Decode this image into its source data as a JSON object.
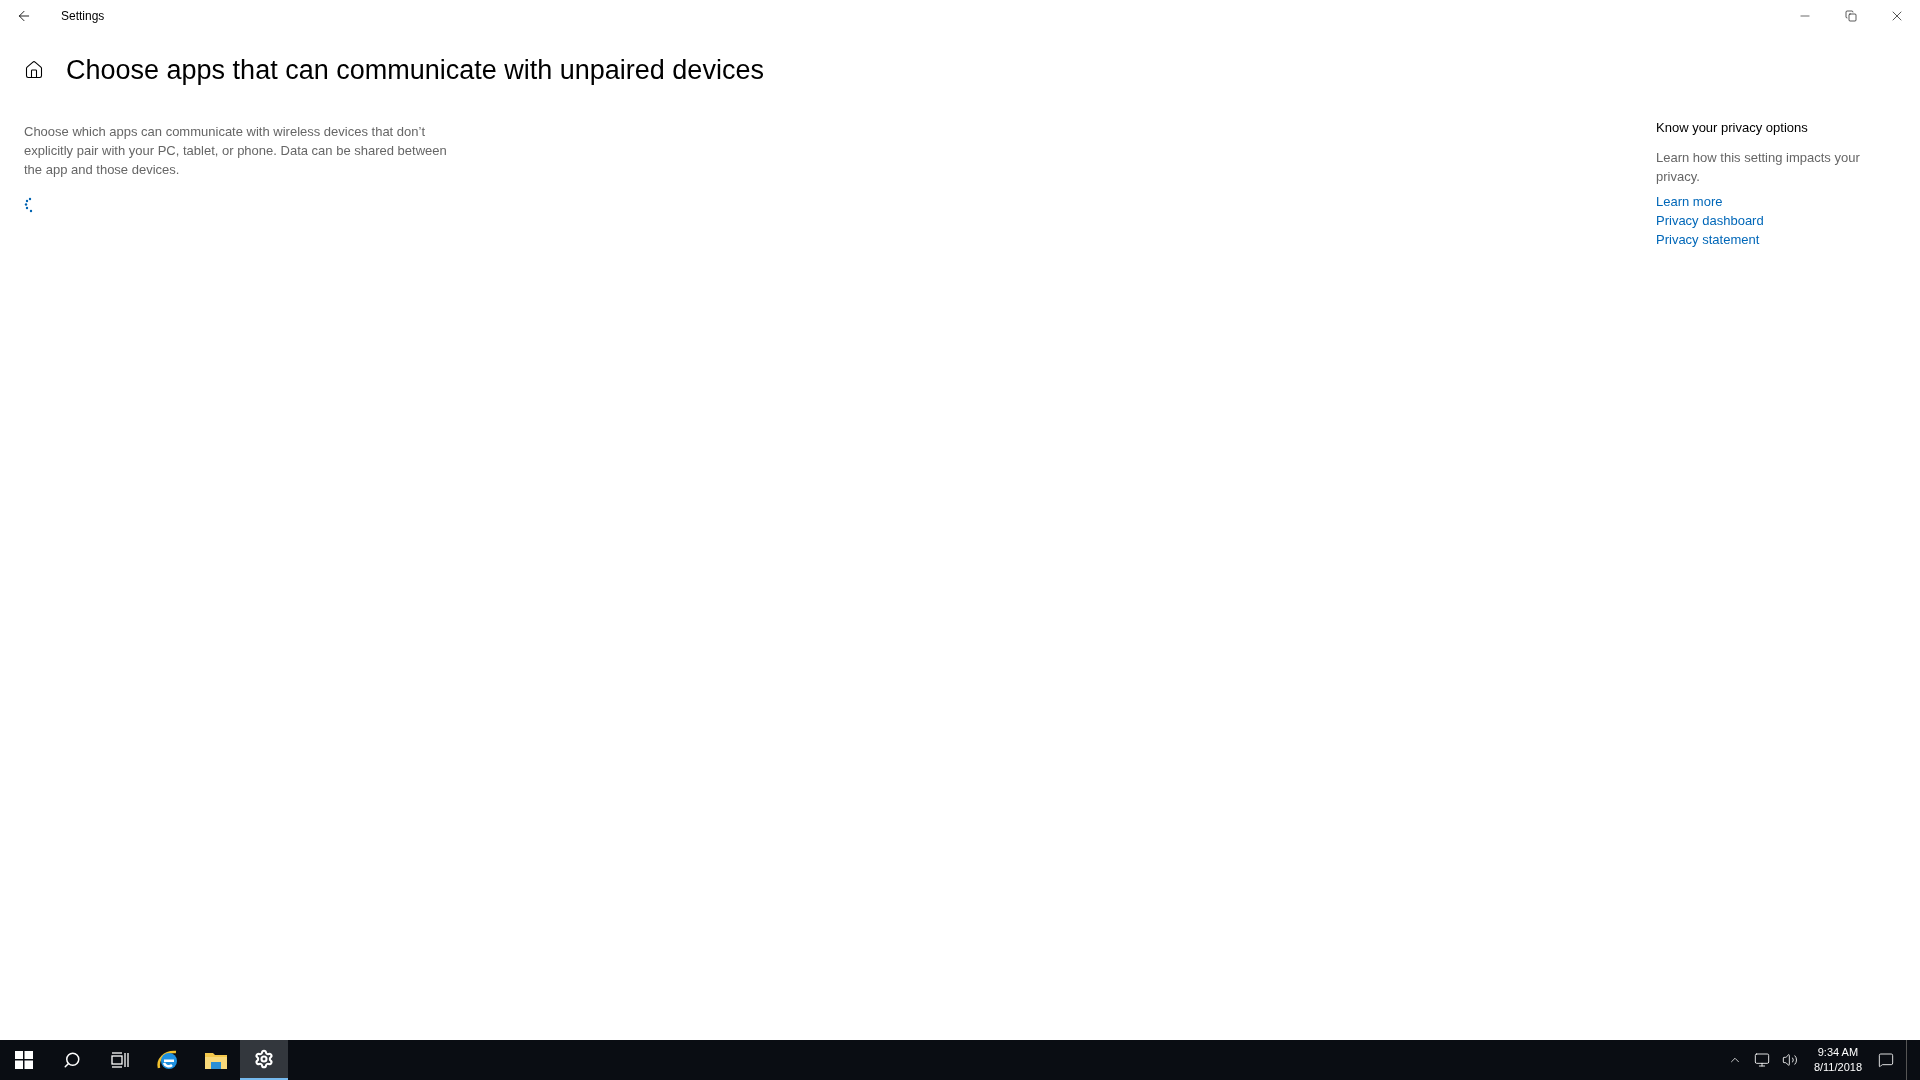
{
  "window": {
    "title": "Settings"
  },
  "page": {
    "heading": "Choose apps that can communicate with unpaired devices",
    "description": "Choose which apps can communicate with wireless devices that don’t explicitly pair with your PC, tablet, or phone. Data can be shared between the app and those devices.",
    "loading": true
  },
  "privacy_panel": {
    "title": "Know your privacy options",
    "text": "Learn how this setting impacts your privacy.",
    "links": [
      "Learn more",
      "Privacy dashboard",
      "Privacy statement"
    ]
  },
  "taskbar": {
    "items": [
      {
        "kind": "start",
        "selected": false
      },
      {
        "kind": "search",
        "selected": false
      },
      {
        "kind": "taskview",
        "selected": false
      },
      {
        "kind": "browser",
        "selected": false
      },
      {
        "kind": "explorer",
        "selected": false
      },
      {
        "kind": "settings",
        "selected": true
      }
    ],
    "time": "9:34 AM",
    "date": "8/11/2018"
  }
}
